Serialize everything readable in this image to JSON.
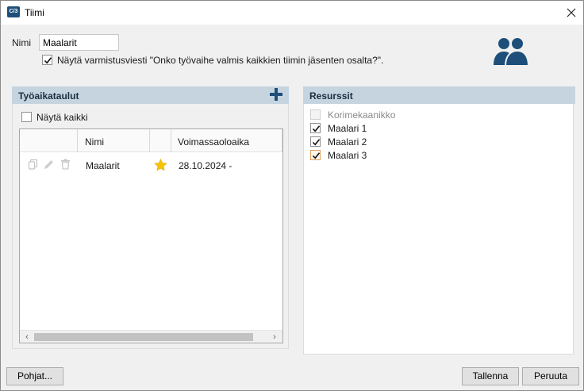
{
  "window": {
    "title": "Tiimi",
    "icon_text": "C/3"
  },
  "name": {
    "label": "Nimi",
    "value": "Maalarit"
  },
  "confirm": {
    "checked": true,
    "label": "Näytä varmistusviesti \"Onko työvaihe valmis kaikkien tiimin jäsenten osalta?\"."
  },
  "schedules": {
    "header": "Työaikataulut",
    "show_all_label": "Näytä kaikki",
    "show_all_checked": false,
    "columns": [
      "Nimi",
      "Voimassaoloaika"
    ],
    "rows": [
      {
        "name": "Maalarit",
        "starred": true,
        "validity": "28.10.2024 -"
      }
    ]
  },
  "resources": {
    "header": "Resurssit",
    "items": [
      {
        "label": "Korimekaanikko",
        "checked": false,
        "disabled": true
      },
      {
        "label": "Maalari 1",
        "checked": true,
        "disabled": false
      },
      {
        "label": "Maalari 2",
        "checked": true,
        "disabled": false
      },
      {
        "label": "Maalari 3",
        "checked": true,
        "disabled": false,
        "highlight": true
      }
    ]
  },
  "buttons": {
    "templates": "Pohjat...",
    "save": "Tallenna",
    "cancel": "Peruuta"
  },
  "colors": {
    "accent": "#1d4f7a",
    "panel_header": "#c5d4df",
    "star": "#f5c400"
  }
}
